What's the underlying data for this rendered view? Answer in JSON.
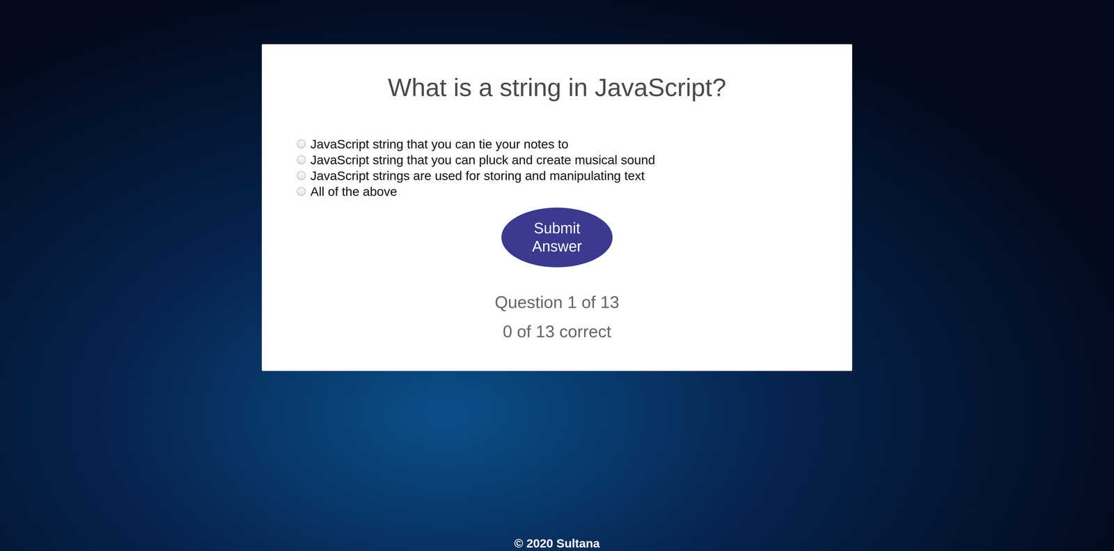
{
  "quiz": {
    "title": "What is a string in JavaScript?",
    "options": [
      {
        "label": "JavaScript string that you can tie your notes to",
        "selected": false
      },
      {
        "label": "JavaScript string that you can pluck and create musical sound",
        "selected": false
      },
      {
        "label": "JavaScript strings are used for storing and manipulating text",
        "selected": false
      },
      {
        "label": "All of the above",
        "selected": false
      }
    ],
    "submit_button": "Submit Answer",
    "progress": "Question 1 of 13",
    "score": "0 of 13 correct"
  },
  "footer": "© 2020 Sultana"
}
